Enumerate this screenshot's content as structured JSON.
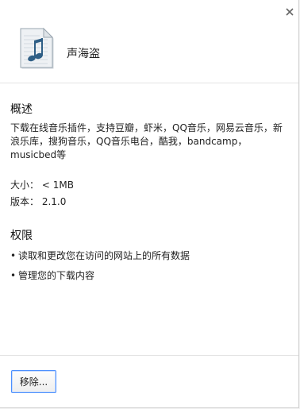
{
  "dialog": {
    "app_name": "声海盗",
    "close_glyph": "×"
  },
  "overview": {
    "title": "概述",
    "description": "下载在线音乐插件，支持豆瓣，虾米，QQ音乐，网易云音乐，新浪乐库，搜狗音乐，QQ音乐电台，酷我，bandcamp，musicbed等",
    "size_label": "大小：",
    "size_value": "< 1MB",
    "version_label": "版本：",
    "version_value": "2.1.0"
  },
  "permissions": {
    "title": "权限",
    "items": [
      "读取和更改您在访问的网站上的所有数据",
      "管理您的下载内容"
    ]
  },
  "footer": {
    "remove_label": "移除..."
  },
  "icons": {
    "app": "music-file-icon",
    "close": "close-icon"
  },
  "colors": {
    "button_border": "#4d90fe",
    "note": "#2f5f86"
  }
}
